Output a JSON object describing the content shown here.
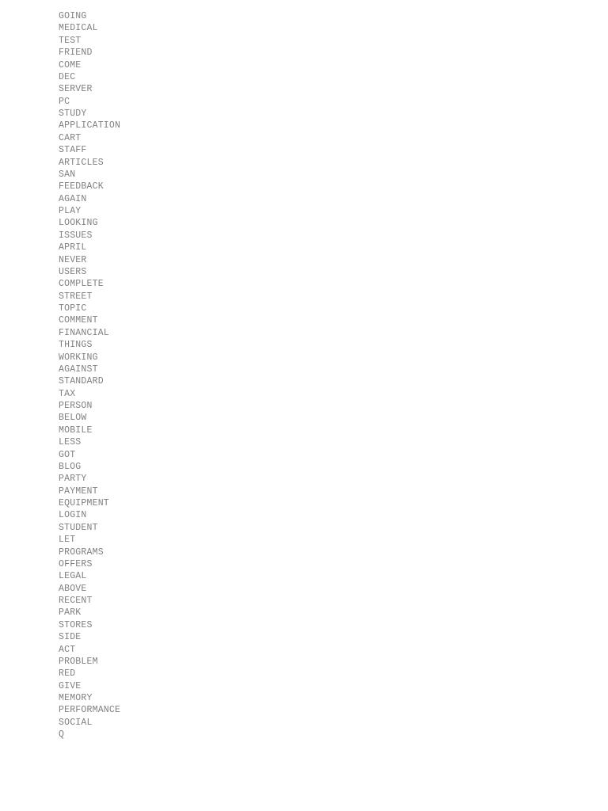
{
  "page": {
    "background_color": "#ffffff",
    "text_color": "#808080",
    "title": "Word List"
  },
  "word_list": {
    "count": 60,
    "items": [
      "GOING",
      "MEDICAL",
      "TEST",
      "FRIEND",
      "COME",
      "DEC",
      "SERVER",
      "PC",
      "STUDY",
      "APPLICATION",
      "CART",
      "STAFF",
      "ARTICLES",
      "SAN",
      "FEEDBACK",
      "AGAIN",
      "PLAY",
      "LOOKING",
      "ISSUES",
      "APRIL",
      "NEVER",
      "USERS",
      "COMPLETE",
      "STREET",
      "TOPIC",
      "COMMENT",
      "FINANCIAL",
      "THINGS",
      "WORKING",
      "AGAINST",
      "STANDARD",
      "TAX",
      "PERSON",
      "BELOW",
      "MOBILE",
      "LESS",
      "GOT",
      "BLOG",
      "PARTY",
      "PAYMENT",
      "EQUIPMENT",
      "LOGIN",
      "STUDENT",
      "LET",
      "PROGRAMS",
      "OFFERS",
      "LEGAL",
      "ABOVE",
      "RECENT",
      "PARK",
      "STORES",
      "SIDE",
      "ACT",
      "PROBLEM",
      "RED",
      "GIVE",
      "MEMORY",
      "PERFORMANCE",
      "SOCIAL",
      "Q"
    ]
  }
}
